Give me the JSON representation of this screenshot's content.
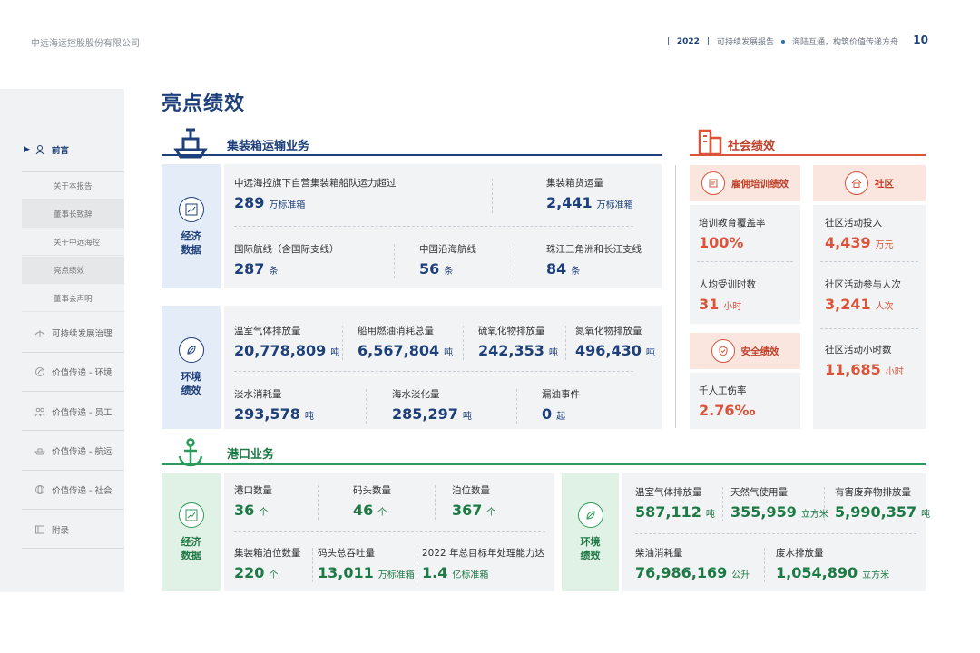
{
  "header": {
    "company": "中远海运控股股份有限公司",
    "year": "2022",
    "report": "可持续发展报告",
    "slogan": "海陆互通，构筑价值传递方舟",
    "page_number": "10"
  },
  "sidebar": {
    "main": {
      "label": "前言"
    },
    "subs": [
      {
        "label": "关于本报告"
      },
      {
        "label": "董事长致辞"
      },
      {
        "label": "关于中远海控"
      },
      {
        "label": "亮点绩效"
      },
      {
        "label": "董事会声明"
      }
    ],
    "items": [
      {
        "label": "可持续发展治理"
      },
      {
        "label": "价值传递 - 环境"
      },
      {
        "label": "价值传递 - 员工"
      },
      {
        "label": "价值传递 - 航运"
      },
      {
        "label": "价值传递 - 社会"
      },
      {
        "label": "附录"
      }
    ]
  },
  "page_title": "亮点绩效",
  "container": {
    "title": "集装箱运输业务",
    "econ": {
      "label": [
        "经济",
        "数据"
      ],
      "metrics": [
        {
          "label": "中远海控旗下自营集装箱船队运力超过",
          "value": "289",
          "unit": "万标准箱"
        },
        {
          "label": "集装箱货运量",
          "value": "2,441",
          "unit": "万标准箱"
        },
        {
          "label": "国际航线（含国际支线）",
          "value": "287",
          "unit": "条"
        },
        {
          "label": "中国沿海航线",
          "value": "56",
          "unit": "条"
        },
        {
          "label": "珠江三角洲和长江支线",
          "value": "84",
          "unit": "条"
        }
      ]
    },
    "env": {
      "label": [
        "环境",
        "绩效"
      ],
      "metrics": [
        {
          "label": "温室气体排放量",
          "value": "20,778,809",
          "unit": "吨"
        },
        {
          "label": "船用燃油消耗总量",
          "value": "6,567,804",
          "unit": "吨"
        },
        {
          "label": "硫氧化物排放量",
          "value": "242,353",
          "unit": "吨"
        },
        {
          "label": "氮氧化物排放量",
          "value": "496,430",
          "unit": "吨"
        },
        {
          "label": "淡水消耗量",
          "value": "293,578",
          "unit": "吨"
        },
        {
          "label": "海水淡化量",
          "value": "285,297",
          "unit": "吨"
        },
        {
          "label": "漏油事件",
          "value": "0",
          "unit": "起"
        }
      ]
    }
  },
  "social": {
    "title": "社会绩效",
    "training": {
      "head": "雇佣培训绩效",
      "metrics": [
        {
          "label": "培训教育覆盖率",
          "value": "100%",
          "unit": ""
        },
        {
          "label": "人均受训时数",
          "value": "31",
          "unit": "小时"
        }
      ]
    },
    "safety": {
      "head": "安全绩效",
      "metrics": [
        {
          "label": "千人工伤率",
          "value": "2.76‰",
          "unit": ""
        }
      ]
    },
    "community": {
      "head": "社区",
      "metrics": [
        {
          "label": "社区活动投入",
          "value": "4,439",
          "unit": "万元"
        },
        {
          "label": "社区活动参与人次",
          "value": "3,241",
          "unit": "人次"
        },
        {
          "label": "社区活动小时数",
          "value": "11,685",
          "unit": "小时"
        }
      ]
    }
  },
  "port": {
    "title": "港口业务",
    "econ": {
      "label": [
        "经济",
        "数据"
      ],
      "metrics": [
        {
          "label": "港口数量",
          "value": "36",
          "unit": "个"
        },
        {
          "label": "码头数量",
          "value": "46",
          "unit": "个"
        },
        {
          "label": "泊位数量",
          "value": "367",
          "unit": "个"
        },
        {
          "label": "集装箱泊位数量",
          "value": "220",
          "unit": "个"
        },
        {
          "label": "码头总吞吐量",
          "value": "13,011",
          "unit": "万标准箱"
        },
        {
          "label": "2022 年总目标年处理能力达",
          "value": "1.4",
          "unit": "亿标准箱"
        }
      ]
    },
    "env": {
      "label": [
        "环境",
        "绩效"
      ],
      "metrics": [
        {
          "label": "温室气体排放量",
          "value": "587,112",
          "unit": "吨"
        },
        {
          "label": "天然气使用量",
          "value": "355,959",
          "unit": "立方米"
        },
        {
          "label": "有害废弃物排放量",
          "value": "5,990,357",
          "unit": "吨"
        },
        {
          "label": "柴油消耗量",
          "value": "76,986,169",
          "unit": "公升"
        },
        {
          "label": "废水排放量",
          "value": "1,054,890",
          "unit": "立方米"
        }
      ]
    }
  },
  "colors": {
    "navy": "#1d3f7a",
    "green": "#1e7a45",
    "red": "#d9543a"
  }
}
